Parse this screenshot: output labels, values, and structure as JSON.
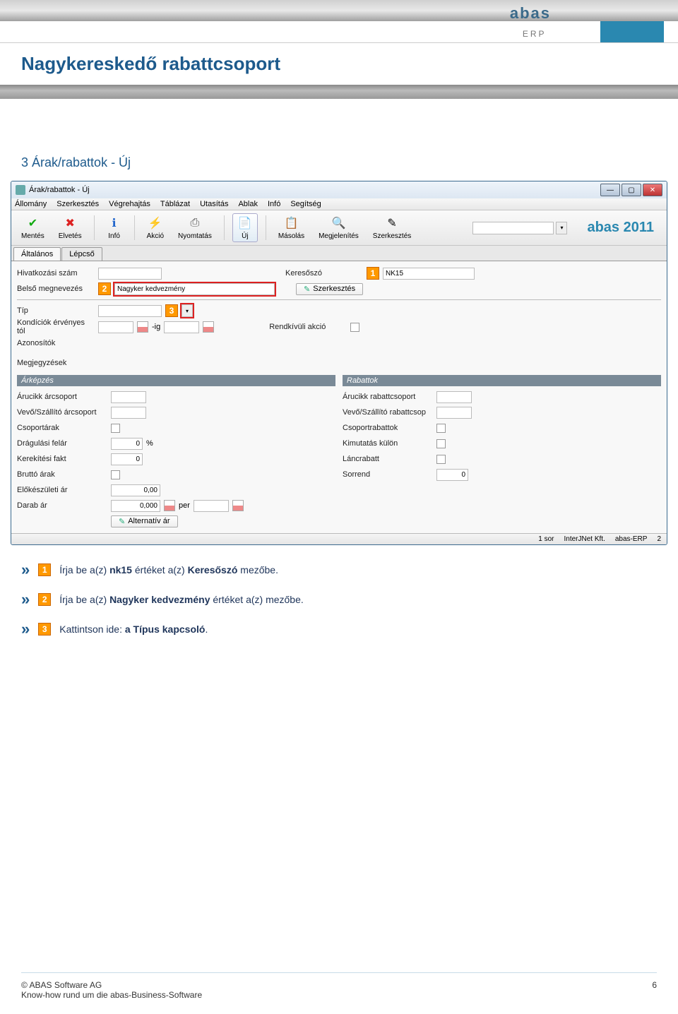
{
  "header_logo": "abas",
  "header_logo_sub": "ERP",
  "doc_title": "Nagykereskedő rabattcsoport",
  "section_title": "3  Árak/rabattok - Új",
  "window": {
    "title": "Árak/rabattok - Új",
    "menu": [
      "Állomány",
      "Szerkesztés",
      "Végrehajtás",
      "Táblázat",
      "Utasítás",
      "Ablak",
      "Infó",
      "Segítség"
    ],
    "toolbar": {
      "mentes": "Mentés",
      "elvetes": "Elvetés",
      "info": "Infó",
      "akcio": "Akció",
      "nyomtatas": "Nyomtatás",
      "uj": "Új",
      "masolas": "Másolás",
      "megjelenites": "Megjelenítés",
      "szerkesztes": "Szerkesztés"
    },
    "brand": "abas 2011",
    "tabs": {
      "altalanos": "Általános",
      "lepcso": "Lépcső"
    },
    "form": {
      "hivatkozasi_szam": "Hivatkozási szám",
      "keresoszo": "Keresőszó",
      "keresoszo_val": "NK15",
      "belso_megnevezes": "Belső megnevezés",
      "belso_megnevezes_val": "Nagyker kedvezmény",
      "szerkesztes_btn": "Szerkesztés",
      "tip": "Típ",
      "kondiciok": "Kondíciók érvényes tól",
      "ig": "-ig",
      "rendkivuli": "Rendkívüli akció",
      "azonositok": "Azonosítók",
      "megjegyzesek": "Megjegyzések"
    },
    "arkepzes": {
      "header": "Árképzés",
      "arucikk": "Árucikk árcsoport",
      "vevo": "Vevő/Szállító árcsoport",
      "csoportarak": "Csoportárak",
      "dragulasi": "Drágulási felár",
      "dragulasi_val": "0",
      "dragulasi_unit": "%",
      "kerekitesi": "Kerekítési fakt",
      "kerekitesi_val": "0",
      "brutto": "Bruttó árak",
      "elokeszuleti": "Előkészületi ár",
      "elokeszuleti_val": "0,00",
      "darab": "Darab ár",
      "darab_val": "0,000",
      "per": "per",
      "alternativ": "Alternatív ár"
    },
    "rabattok": {
      "header": "Rabattok",
      "arucikk": "Árucikk rabattcsoport",
      "vevo": "Vevő/Szállító rabattcsop",
      "csoportrabattok": "Csoportrabattok",
      "kimutatas": "Kimutatás külön",
      "lancrabatt": "Láncrabatt",
      "sorrend": "Sorrend",
      "sorrend_val": "0"
    },
    "status": {
      "sor": "1 sor",
      "company": "InterJNet Kft.",
      "product": "abas-ERP",
      "num": "2"
    }
  },
  "markers": {
    "m1": "1",
    "m2": "2",
    "m3": "3"
  },
  "instructions": {
    "i1_a": "Írja be a(z) ",
    "i1_b": "nk15",
    "i1_c": " értéket a(z) ",
    "i1_d": "Keresőszó",
    "i1_e": " mezőbe.",
    "i2_a": "Írja be a(z) ",
    "i2_b": "Nagyker kedvezmény",
    "i2_c": " értéket a(z)     mezőbe.",
    "i3_a": "Kattintson ide: ",
    "i3_b": "a Típus kapcsoló",
    "i3_c": "."
  },
  "footer": {
    "copyright": "© ABAS Software AG",
    "tagline": "Know-how rund um die abas-Business-Software",
    "page": "6"
  }
}
